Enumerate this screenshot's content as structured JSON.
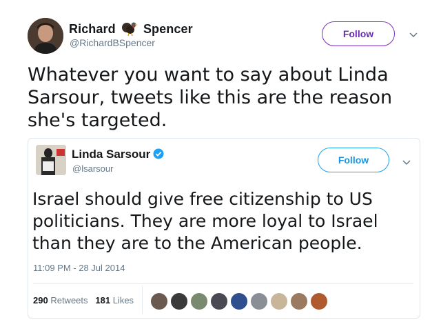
{
  "tweet": {
    "author": {
      "name_first": "Richard",
      "name_last": "Spencer",
      "handle": "@RichardBSpencer"
    },
    "follow_label": "Follow",
    "text": "Whatever you want to say about Linda Sarsour, tweets like this are the reason she's targeted."
  },
  "quoted": {
    "author": {
      "name": "Linda Sarsour",
      "handle": "@lsarsour"
    },
    "follow_label": "Follow",
    "text": "Israel should give free citizenship to US politicians. They are more loyal to Israel than they are to the American people.",
    "timestamp": "11:09 PM - 28 Jul 2014",
    "retweets_count": "290",
    "retweets_label": "Retweets",
    "likes_count": "181",
    "likes_label": "Likes"
  },
  "colors": {
    "outer_follow": "#7b2fbf",
    "inner_follow": "#1da1f2",
    "verified": "#1da1f2"
  }
}
